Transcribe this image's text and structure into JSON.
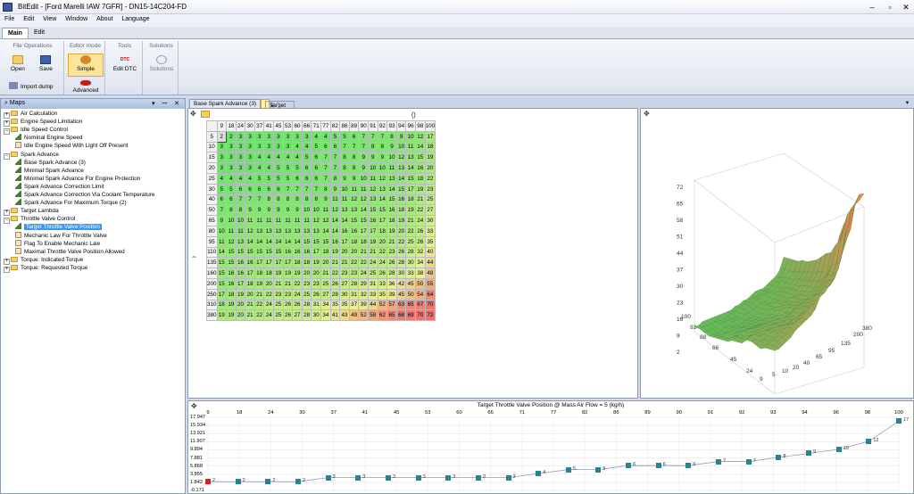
{
  "window": {
    "title": "BitEdit - [Ford Marelli IAW 7GFR] - DN15-14C204-FD",
    "minimize": "–",
    "restore": "▫",
    "close": "✕"
  },
  "menu": [
    "File",
    "Edit",
    "View",
    "Window",
    "About",
    "Language"
  ],
  "ribbon_tabs": [
    "Main",
    "Edit"
  ],
  "ribbon": {
    "file_ops_title": "File Operations",
    "open": "Open",
    "save": "Save",
    "import_dump": "Import dump",
    "editor_mode_title": "Editor mode",
    "simple": "Simple",
    "advanced": "Advanced",
    "tools_title": "Tools",
    "edit_dtc": "Edit DTC",
    "dtc_badge": "DTC",
    "solutions_title": "Solutions",
    "solutions": "Solutions"
  },
  "maps_panel": {
    "title": "Maps",
    "controls": "▾ ꟷ ✕"
  },
  "tree": [
    {
      "label": "Air Calculation",
      "kind": "folder",
      "level": 0,
      "exp": "+"
    },
    {
      "label": "Engine Speed Limitation",
      "kind": "folder",
      "level": 0,
      "exp": "+"
    },
    {
      "label": "Idle Speed Control",
      "kind": "folder",
      "level": 0,
      "exp": "−"
    },
    {
      "label": "Nominal Engine Speed",
      "kind": "curve",
      "level": 1
    },
    {
      "label": "Idle Engine Speed With Light Off Present",
      "kind": "table",
      "level": 1
    },
    {
      "label": "Spark Advance",
      "kind": "folder",
      "level": 0,
      "exp": "−"
    },
    {
      "label": "Base Spark Advance (3)",
      "kind": "curve",
      "level": 1
    },
    {
      "label": "Minimal Spark Advance",
      "kind": "curve",
      "level": 1
    },
    {
      "label": "Minimal Spark Advance For Engine Protection",
      "kind": "curve",
      "level": 1
    },
    {
      "label": "Spark Advance Correction Limit",
      "kind": "curve",
      "level": 1
    },
    {
      "label": "Spark Advance Correction Via Coolant Temperature",
      "kind": "curve",
      "level": 1
    },
    {
      "label": "Spark Advance For Maximum Torque (2)",
      "kind": "curve",
      "level": 1
    },
    {
      "label": "Target Lambda",
      "kind": "folder",
      "level": 0,
      "exp": "+"
    },
    {
      "label": "Throttle Valve Control",
      "kind": "folder",
      "level": 0,
      "exp": "−"
    },
    {
      "label": "Target Throttle Valve Position",
      "kind": "curve",
      "level": 1,
      "selected": true
    },
    {
      "label": "Mechanic Law For Throttle Valve",
      "kind": "table",
      "level": 1
    },
    {
      "label": "Flag To Enable Mechanic Law",
      "kind": "table",
      "level": 1
    },
    {
      "label": "Maximal Throttle Valve Position Allowed",
      "kind": "table",
      "level": 1
    },
    {
      "label": "Torque: Indicated Torque",
      "kind": "folder",
      "level": 0,
      "exp": "+"
    },
    {
      "label": "Torque: Requested Torque",
      "kind": "folder",
      "level": 0,
      "exp": "+"
    }
  ],
  "doc_tabs": [
    "Base Spark Advance (3)",
    "Target Throttle Valve Position"
  ],
  "doc_tab_close": "✕",
  "grid": {
    "unit_label": "()",
    "x_axis": [
      9,
      18,
      24,
      30,
      37,
      41,
      45,
      53,
      60,
      66,
      71,
      77,
      82,
      86,
      89,
      90,
      91,
      92,
      93,
      94,
      96,
      98,
      100
    ],
    "y_axis": [
      5,
      10,
      15,
      20,
      25,
      30,
      40,
      50,
      65,
      80,
      95,
      110,
      135,
      160,
      200,
      250,
      310,
      380
    ],
    "rows": [
      [
        2,
        2,
        3,
        3,
        3,
        3,
        3,
        3,
        3,
        3,
        4,
        4,
        5,
        5,
        6,
        7,
        7,
        7,
        8,
        9,
        10,
        12,
        17
      ],
      [
        2,
        3,
        3,
        3,
        3,
        3,
        3,
        3,
        3,
        3,
        4,
        4,
        5,
        6,
        6,
        7,
        7,
        7,
        8,
        8,
        9,
        10,
        11,
        14,
        18
      ],
      [
        2,
        3,
        3,
        3,
        3,
        4,
        4,
        4,
        4,
        4,
        5,
        6,
        7,
        7,
        8,
        8,
        9,
        9,
        9,
        10,
        12,
        13,
        15,
        19
      ],
      [
        3,
        3,
        3,
        3,
        3,
        3,
        4,
        4,
        5,
        5,
        5,
        6,
        6,
        7,
        7,
        8,
        8,
        9,
        10,
        10,
        11,
        13,
        14,
        16,
        20
      ],
      [
        3,
        4,
        4,
        4,
        4,
        5,
        5,
        5,
        5,
        6,
        6,
        6,
        7,
        8,
        9,
        9,
        10,
        11,
        12,
        13,
        14,
        15,
        18,
        22
      ],
      [
        4,
        5,
        5,
        6,
        6,
        6,
        6,
        6,
        7,
        7,
        7,
        7,
        8,
        9,
        10,
        11,
        11,
        12,
        13,
        14,
        15,
        17,
        19,
        23
      ],
      [
        5,
        6,
        6,
        7,
        7,
        7,
        8,
        8,
        8,
        8,
        8,
        8,
        9,
        11,
        11,
        12,
        12,
        13,
        14,
        15,
        16,
        18,
        21,
        25
      ],
      [
        7,
        8,
        8,
        9,
        9,
        9,
        9,
        9,
        9,
        10,
        10,
        11,
        12,
        13,
        13,
        14,
        15,
        15,
        16,
        18,
        19,
        22,
        27
      ],
      [
        9,
        10,
        10,
        11,
        11,
        11,
        11,
        11,
        11,
        11,
        12,
        12,
        14,
        14,
        15,
        15,
        16,
        17,
        18,
        19,
        21,
        24,
        30
      ],
      [
        10,
        11,
        11,
        12,
        13,
        13,
        13,
        13,
        13,
        13,
        13,
        14,
        14,
        16,
        16,
        17,
        17,
        18,
        19,
        20,
        22,
        26,
        33
      ],
      [
        11,
        12,
        13,
        14,
        14,
        14,
        14,
        14,
        14,
        15,
        15,
        15,
        16,
        17,
        18,
        18,
        19,
        20,
        21,
        22,
        25,
        26,
        35
      ],
      [
        12,
        13,
        14,
        15,
        15,
        15,
        15,
        15,
        15,
        16,
        16,
        16,
        17,
        18,
        19,
        20,
        20,
        21,
        21,
        22,
        23,
        26,
        28,
        32,
        40
      ],
      [
        14,
        15,
        15,
        16,
        16,
        17,
        17,
        17,
        17,
        18,
        18,
        19,
        20,
        21,
        21,
        22,
        22,
        24,
        24,
        26,
        28,
        30,
        34,
        44
      ],
      [
        14,
        15,
        16,
        16,
        17,
        18,
        18,
        19,
        19,
        19,
        20,
        20,
        21,
        22,
        23,
        23,
        24,
        25,
        26,
        28,
        30,
        33,
        38,
        48
      ],
      [
        14,
        15,
        16,
        17,
        18,
        19,
        20,
        21,
        21,
        22,
        23,
        23,
        25,
        26,
        27,
        28,
        29,
        31,
        33,
        36,
        42,
        45,
        50,
        55
      ],
      [
        15,
        16,
        17,
        18,
        19,
        20,
        21,
        22,
        23,
        23,
        24,
        25,
        26,
        27,
        28,
        30,
        31,
        32,
        33,
        35,
        39,
        45,
        50,
        54,
        64
      ],
      [
        17,
        18,
        18,
        19,
        20,
        21,
        22,
        24,
        25,
        26,
        26,
        28,
        31,
        34,
        35,
        35,
        37,
        39,
        44,
        52,
        57,
        63,
        65,
        67,
        70
      ],
      [
        18,
        19,
        19,
        20,
        21,
        22,
        24,
        25,
        26,
        27,
        28,
        30,
        34,
        41,
        43,
        49,
        52,
        58,
        62,
        65,
        68,
        69,
        70,
        72
      ]
    ]
  },
  "plot3d": {
    "z_ticks": [
      72,
      65,
      58,
      51,
      44,
      37,
      30,
      23,
      16,
      9,
      2
    ],
    "y_ticks": [
      100,
      92,
      88,
      66,
      45,
      24,
      9
    ],
    "x_ticks": [
      5,
      10,
      20,
      40,
      65,
      95,
      135,
      200,
      380
    ]
  },
  "curve_chart": {
    "title": "Target Throttle Valve Position @ Mass Air Flow = 5 (kg/h)",
    "x_ticks": [
      "9",
      "18",
      "24",
      "30",
      "37",
      "41",
      "45",
      "53",
      "60",
      "66",
      "71",
      "77",
      "82",
      "86",
      "89",
      "90",
      "91",
      "92",
      "93",
      "94",
      "96",
      "98",
      "100"
    ],
    "y_ticks": [
      "17.947",
      "15.934",
      "13.921",
      "11.907",
      "9.894",
      "7.881",
      "5.868",
      "3.855",
      "1.842",
      "-0.171"
    ],
    "ylim": [
      -0.171,
      17.947
    ]
  },
  "chart_data": {
    "type": "line",
    "title": "Target Throttle Valve Position @ Mass Air Flow = 5 (kg/h)",
    "x": [
      9,
      18,
      24,
      30,
      37,
      41,
      45,
      53,
      60,
      66,
      71,
      77,
      82,
      86,
      89,
      90,
      91,
      92,
      93,
      94,
      96,
      98,
      100
    ],
    "series": [
      {
        "values": [
          2,
          2,
          2,
          2,
          3,
          3,
          3,
          3,
          3,
          3,
          3,
          4,
          5,
          5,
          6,
          6,
          6,
          7,
          7,
          8,
          9,
          10,
          12,
          17
        ]
      }
    ],
    "ylim": [
      -0.171,
      17.947
    ]
  }
}
